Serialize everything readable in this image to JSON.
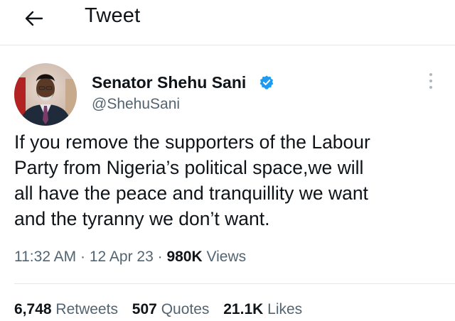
{
  "header": {
    "title": "Tweet",
    "back_icon": "arrow-left-icon"
  },
  "author": {
    "name": "Senator Shehu Sani",
    "handle": "@ShehuSani",
    "verified_icon": "verified-badge-icon",
    "verified_color": "#1d9bf0"
  },
  "tweet": {
    "lines": [
      "If you remove the supporters of the Labour",
      "Party from Nigeria’s political space,we will",
      "all have the peace and tranquillity we want",
      "and the tyranny we don’t want."
    ],
    "time": "11:32 AM",
    "date": "12 Apr 23",
    "separator": "·",
    "views_count": "980K",
    "views_label": "Views"
  },
  "stats": {
    "retweets_count": "6,748",
    "retweets_label": "Retweets",
    "quotes_count": "507",
    "quotes_label": "Quotes",
    "likes_count": "21.1K",
    "likes_label": "Likes"
  },
  "colors": {
    "text_primary": "#0f1419",
    "text_secondary": "#536471",
    "divider": "#e6e6e6"
  }
}
